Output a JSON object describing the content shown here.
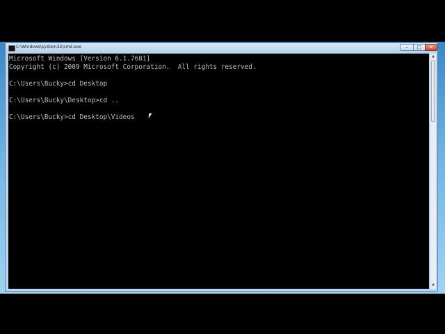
{
  "window": {
    "title": "C:\\Windows\\system32\\cmd.exe",
    "buttons": {
      "minimize": "–",
      "maximize": "□",
      "close": "✕"
    }
  },
  "console": {
    "lines": [
      "Microsoft Windows [Version 6.1.7601]",
      "Copyright (c) 2009 Microsoft Corporation.  All rights reserved.",
      "",
      "C:\\Users\\Bucky>cd Desktop",
      "",
      "C:\\Users\\Bucky\\Desktop>cd ..",
      "",
      "C:\\Users\\Bucky>cd Desktop\\Videos"
    ]
  },
  "scrollbar": {
    "up_arrow": "▲",
    "down_arrow": "▼"
  },
  "icons": {
    "app": "cmd-icon",
    "pointer": "mouse-pointer-icon"
  },
  "colors": {
    "console_bg": "#000000",
    "console_text": "#c0c0c0",
    "chrome": "#bcd6ef"
  }
}
